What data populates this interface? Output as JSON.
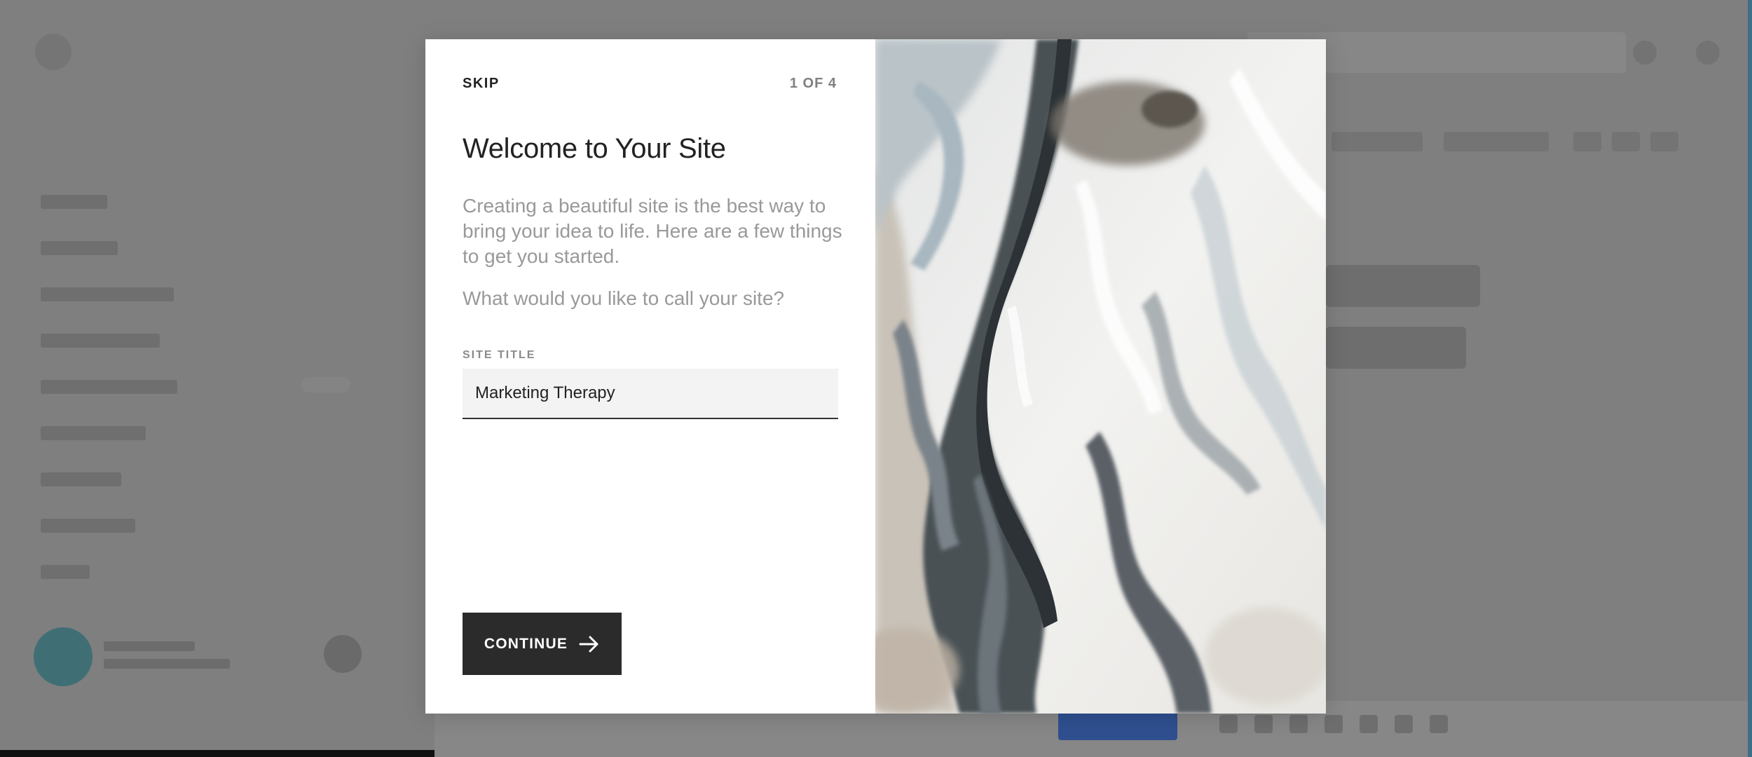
{
  "modal": {
    "skip_label": "SKIP",
    "step_label": "1 OF 4",
    "title": "Welcome to Your Site",
    "description": "Creating a beautiful site is the best way to bring your idea to life. Here are a few things to get you started.",
    "question": "What would you like to call your site?",
    "site_title_label": "SITE TITLE",
    "site_title_value": "Marketing Therapy",
    "continue_label": "CONTINUE",
    "continue_icon": "arrow-right-icon",
    "image": "marble-art-image"
  },
  "colors": {
    "overlay": "#7f7f7f",
    "button_bg": "#2b2b2b",
    "text_dark": "#222222",
    "text_muted": "#999999",
    "input_bg": "#f3f3f3"
  }
}
